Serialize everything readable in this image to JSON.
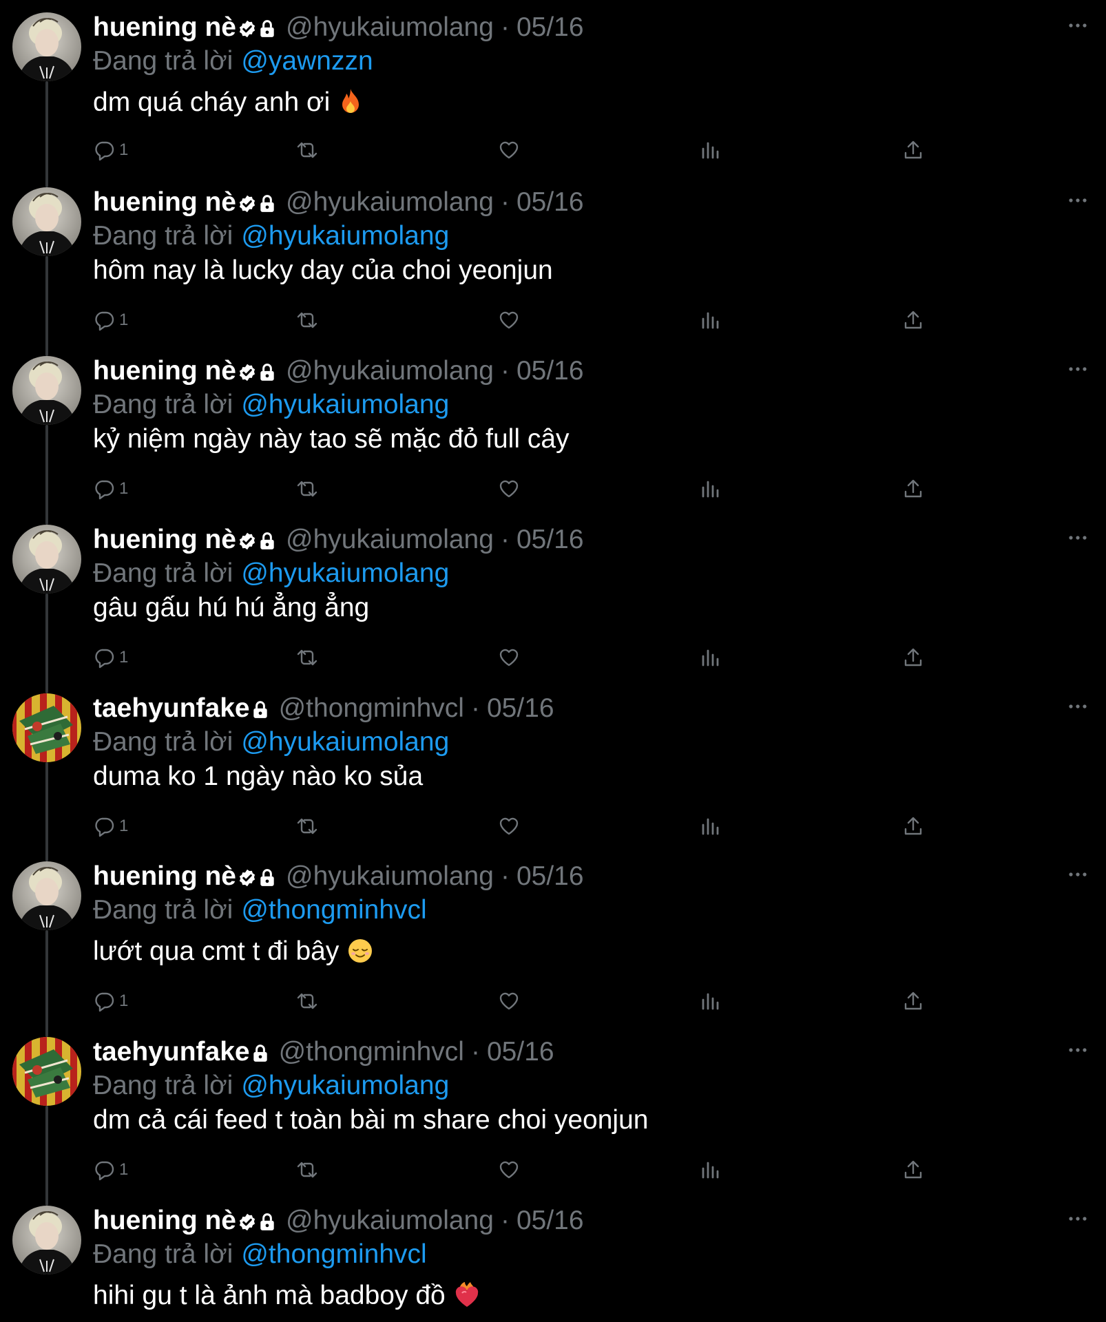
{
  "colors": {
    "background": "#000000",
    "primary_text": "#ffffff",
    "secondary_text": "#71767b",
    "link": "#1d9bf0",
    "thread_line": "#333639"
  },
  "tweets": [
    {
      "name": "huening nè",
      "verified": true,
      "protected": true,
      "handle": "@hyukaiumolang",
      "dot": "·",
      "date": "05/16",
      "reply_prefix": "Đang trả lời",
      "reply_to": "@yawnzzn",
      "text": "dm quá cháy anh ơi",
      "emoji": "fire-emoji",
      "avatar": "avatar-huening",
      "reply_count": "1"
    },
    {
      "name": "huening nè",
      "verified": true,
      "protected": true,
      "handle": "@hyukaiumolang",
      "dot": "·",
      "date": "05/16",
      "reply_prefix": "Đang trả lời",
      "reply_to": "@hyukaiumolang",
      "text": "hôm nay là lucky day của choi yeonjun",
      "avatar": "avatar-huening",
      "reply_count": "1"
    },
    {
      "name": "huening nè",
      "verified": true,
      "protected": true,
      "handle": "@hyukaiumolang",
      "dot": "·",
      "date": "05/16",
      "reply_prefix": "Đang trả lời",
      "reply_to": "@hyukaiumolang",
      "text": "kỷ niệm ngày này tao sẽ mặc đỏ full cây",
      "avatar": "avatar-huening",
      "reply_count": "1"
    },
    {
      "name": "huening nè",
      "verified": true,
      "protected": true,
      "handle": "@hyukaiumolang",
      "dot": "·",
      "date": "05/16",
      "reply_prefix": "Đang trả lời",
      "reply_to": "@hyukaiumolang",
      "text": "gâu gấu hú hú ẳng ẳng",
      "avatar": "avatar-huening",
      "reply_count": "1"
    },
    {
      "name": "taehyunfake",
      "verified": false,
      "protected": true,
      "handle": "@thongminhvcl",
      "dot": "·",
      "date": "05/16",
      "reply_prefix": "Đang trả lời",
      "reply_to": "@hyukaiumolang",
      "text": "duma ko 1 ngày nào ko sủa",
      "avatar": "avatar-taehyun",
      "reply_count": "1"
    },
    {
      "name": "huening nè",
      "verified": true,
      "protected": true,
      "handle": "@hyukaiumolang",
      "dot": "·",
      "date": "05/16",
      "reply_prefix": "Đang trả lời",
      "reply_to": "@thongminhvcl",
      "text": "lướt qua cmt t đi bây",
      "emoji": "relieved-face-emoji",
      "avatar": "avatar-huening",
      "reply_count": "1"
    },
    {
      "name": "taehyunfake",
      "verified": false,
      "protected": true,
      "handle": "@thongminhvcl",
      "dot": "·",
      "date": "05/16",
      "reply_prefix": "Đang trả lời",
      "reply_to": "@hyukaiumolang",
      "text": "dm cả cái feed t toàn bài m share choi yeonjun",
      "avatar": "avatar-taehyun",
      "reply_count": "1"
    },
    {
      "name": "huening nè",
      "verified": true,
      "protected": true,
      "handle": "@hyukaiumolang",
      "dot": "·",
      "date": "05/16",
      "reply_prefix": "Đang trả lời",
      "reply_to": "@thongminhvcl",
      "text": "hihi gu t là ảnh mà badboy đồ",
      "emoji": "heart-on-fire-emoji",
      "avatar": "avatar-huening",
      "reply_count": null
    }
  ],
  "icons": {
    "reply": "reply-icon",
    "retweet": "retweet-icon",
    "like": "like-icon",
    "views": "views-icon",
    "share": "share-icon",
    "more": "more-icon",
    "verified": "verified-badge-icon",
    "protected": "lock-icon"
  }
}
